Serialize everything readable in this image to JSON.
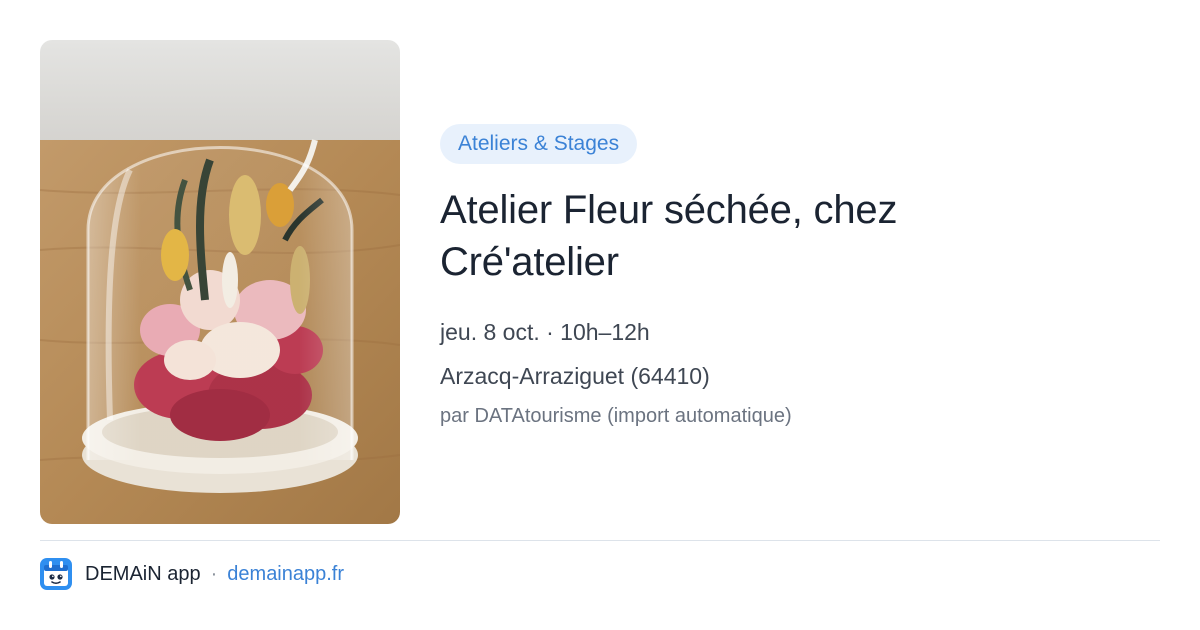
{
  "event": {
    "category": "Ateliers & Stages",
    "title_line1": "Atelier Fleur séchée, chez",
    "title_line2": "Cré'atelier",
    "date": "jeu. 8 oct. · 10h–12h",
    "location": "Arzacq-Arraziguet (64410)",
    "source": "par DATAtourisme (import automatique)"
  },
  "footer": {
    "app_name": "DEMAiN app",
    "separator": "·",
    "link": "demainapp.fr",
    "logo_icon": "demain-app-logo-icon"
  },
  "colors": {
    "accent": "#3b82d6",
    "badge_bg": "#e8f1fc",
    "title": "#1b2432",
    "text": "#3f4753",
    "muted": "#6b7380",
    "divider": "#dde3ea"
  }
}
